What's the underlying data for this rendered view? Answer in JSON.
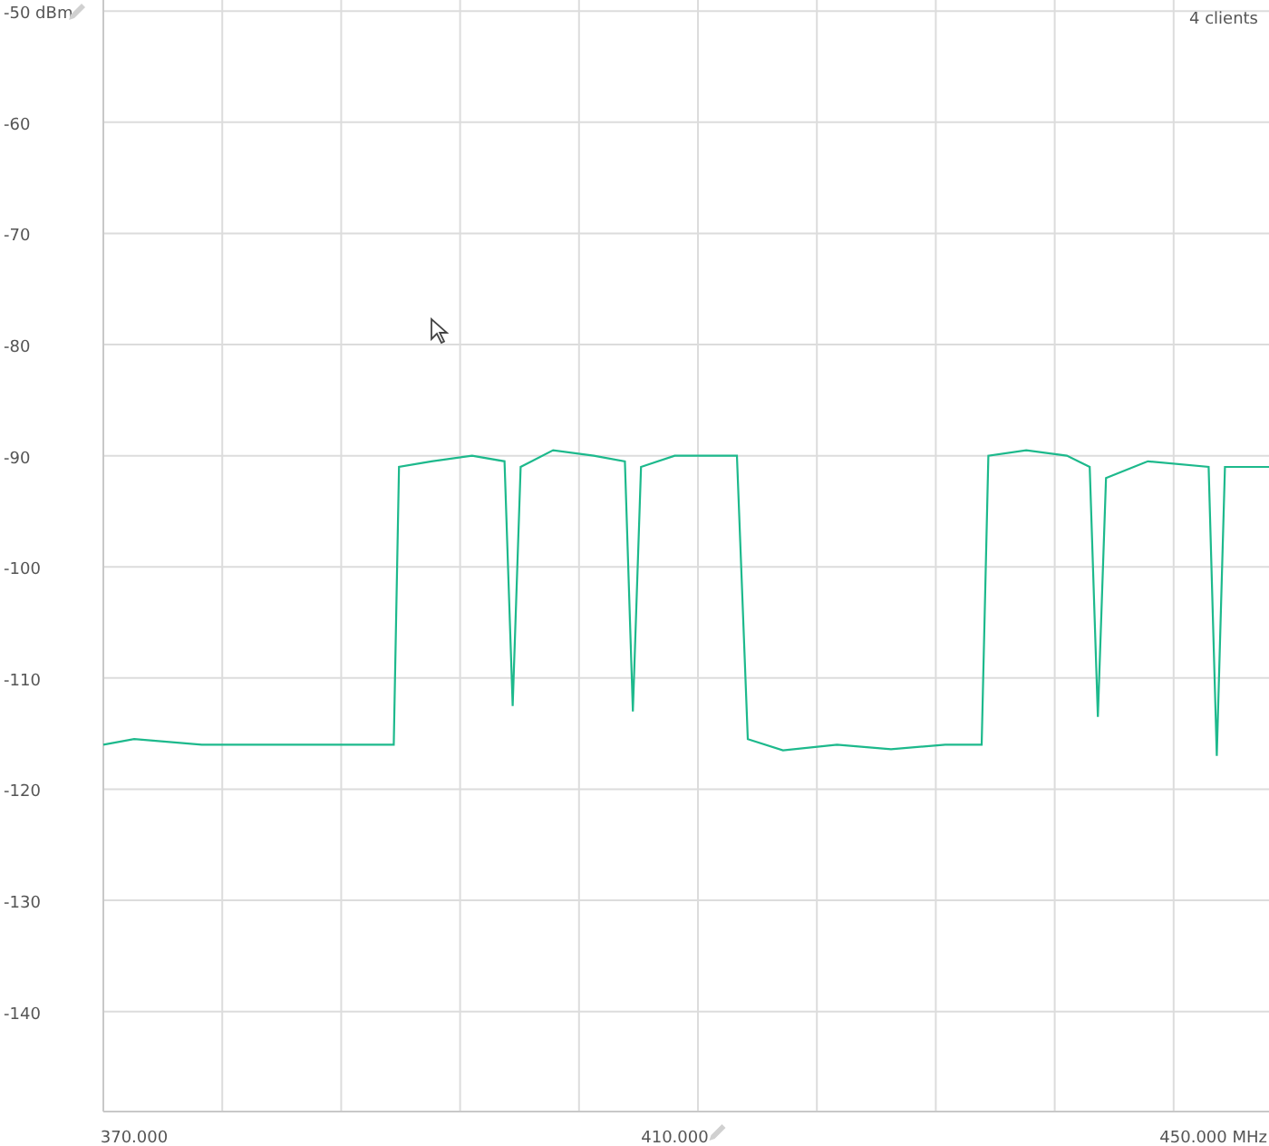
{
  "clients_label": "4 clients",
  "chart_data": {
    "type": "line",
    "grid": true,
    "xlim": [
      367720,
      453960
    ],
    "ylim": [
      -149,
      -49
    ],
    "yticks": [
      {
        "value": -50,
        "label": "-50 dBm"
      },
      -60,
      -70,
      -80,
      -90,
      -100,
      -110,
      -120,
      -130,
      -140
    ],
    "xticks": [
      {
        "value": 370000,
        "label": "370.000"
      },
      {
        "value": 410000,
        "label": "410.000"
      },
      {
        "value": 450000,
        "label": "450.000 MHz"
      }
    ],
    "x": [
      367720,
      370000,
      375000,
      380000,
      385000,
      389200,
      389600,
      392000,
      395000,
      397400,
      398000,
      398600,
      401000,
      404000,
      406300,
      406900,
      407500,
      410000,
      414600,
      415400,
      418000,
      422000,
      426000,
      430000,
      432700,
      433200,
      436000,
      439000,
      440700,
      441300,
      441900,
      445000,
      449500,
      450100,
      450700,
      453960
    ],
    "series": [
      {
        "color": "#1db98c",
        "values": [
          -116,
          -115.5,
          -116,
          -116,
          -116,
          -116,
          -91,
          -90.5,
          -90,
          -90.5,
          -112.5,
          -91,
          -89.5,
          -90,
          -90.5,
          -113,
          -91,
          -90,
          -90,
          -115.5,
          -116.5,
          -116,
          -116.4,
          -116,
          -116,
          -90,
          -89.5,
          -90,
          -91,
          -113.5,
          -92,
          -90.5,
          -91,
          -117,
          -91,
          -91
        ]
      }
    ]
  }
}
